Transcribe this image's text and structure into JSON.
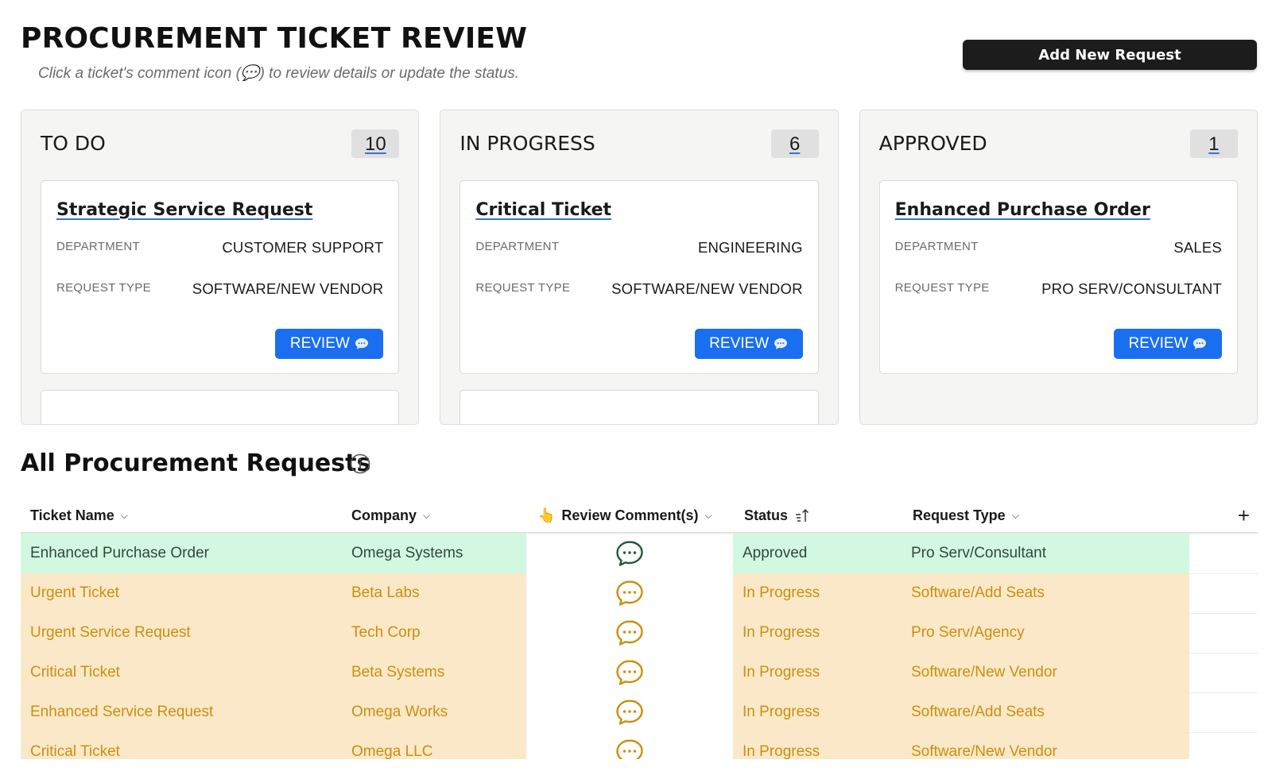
{
  "header": {
    "title": "PROCUREMENT TICKET REVIEW",
    "subtitle": "Click a ticket's comment icon (💬) to review details or update the status.",
    "add_button_label": "Add New Request"
  },
  "kanban": {
    "columns": [
      {
        "title": "TO DO",
        "count": "10",
        "card": {
          "title": "Strategic Service Request",
          "department_label": "DEPARTMENT",
          "department": "CUSTOMER SUPPORT",
          "request_type_label": "REQUEST TYPE",
          "request_type": "SOFTWARE/NEW VENDOR",
          "review_label": "REVIEW"
        }
      },
      {
        "title": "IN PROGRESS",
        "count": "6",
        "card": {
          "title": "Critical Ticket",
          "department_label": "DEPARTMENT",
          "department": "ENGINEERING",
          "request_type_label": "REQUEST TYPE",
          "request_type": "SOFTWARE/NEW VENDOR",
          "review_label": "REVIEW"
        }
      },
      {
        "title": "APPROVED",
        "count": "1",
        "card": {
          "title": "Enhanced Purchase Order",
          "department_label": "DEPARTMENT",
          "department": "SALES",
          "request_type_label": "REQUEST TYPE",
          "request_type": "PRO SERV/CONSULTANT",
          "review_label": "REVIEW"
        }
      }
    ]
  },
  "table": {
    "title": "All Procurement Requests",
    "headers": {
      "ticket_name": "Ticket Name",
      "company": "Company",
      "review_emoji": "👆",
      "review_comments": "Review Comment(s)",
      "status": "Status",
      "request_type": "Request Type"
    },
    "rows": [
      {
        "ticket": "Enhanced Purchase Order",
        "company": "Omega Systems",
        "status": "Approved",
        "type": "Pro Serv/Consultant"
      },
      {
        "ticket": "Urgent Ticket",
        "company": "Beta Labs",
        "status": "In Progress",
        "type": "Software/Add Seats"
      },
      {
        "ticket": "Urgent Service Request",
        "company": "Tech Corp",
        "status": "In Progress",
        "type": "Pro Serv/Agency"
      },
      {
        "ticket": "Critical Ticket",
        "company": "Beta Systems",
        "status": "In Progress",
        "type": "Software/New Vendor"
      },
      {
        "ticket": "Enhanced Service Request",
        "company": "Omega Works",
        "status": "In Progress",
        "type": "Software/Add Seats"
      },
      {
        "ticket": "Critical Ticket",
        "company": "Omega LLC",
        "status": "In Progress",
        "type": "Software/New Vendor"
      }
    ]
  },
  "colors": {
    "approved_bg": "#d3f8e1",
    "approved_text": "#2e4a3a",
    "approved_icon": "#1f5a38",
    "in_progress_bg": "#fbe8c8",
    "in_progress_text": "#c8900f",
    "in_progress_icon": "#c8900f",
    "accent_blue": "#1a6ef0"
  }
}
